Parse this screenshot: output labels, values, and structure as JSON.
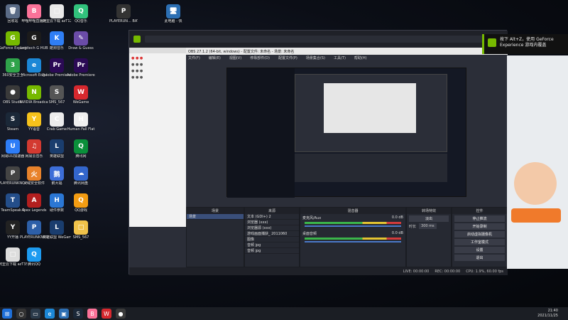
{
  "desktop": {
    "icons": [
      {
        "label": "回收站",
        "glyph": "🗑",
        "color": "#5a6b86"
      },
      {
        "label": "哔哩哔哩直播姬",
        "glyph": "B",
        "color": "#fb7299"
      },
      {
        "label": "GeForce Experience",
        "glyph": "G",
        "color": "#76b900"
      },
      {
        "label": "Logitech G HUB",
        "glyph": "G",
        "color": "#1b1b1b"
      },
      {
        "label": "360安全卫士",
        "glyph": "3",
        "color": "#2fa34a"
      },
      {
        "label": "Microsoft Edge",
        "glyph": "e",
        "color": "#1c87d6"
      },
      {
        "label": "OBS Studio",
        "glyph": "●",
        "color": "#3a3a3a"
      },
      {
        "label": "NVIDIA Broadcast",
        "glyph": "N",
        "color": "#76b900"
      },
      {
        "label": "Steam",
        "glyph": "S",
        "color": "#1b2838"
      },
      {
        "label": "YY语音",
        "glyph": "Y",
        "color": "#f6c21b"
      },
      {
        "label": "网易UU加速器",
        "glyph": "U",
        "color": "#2e7df7"
      },
      {
        "label": "网易云音乐",
        "glyph": "♫",
        "color": "#d33a31"
      },
      {
        "label": "PLAYERUNKNOWN'S BATTLEGROUNDS",
        "glyph": "P",
        "color": "#444"
      },
      {
        "label": "火绒安全软件",
        "glyph": "火",
        "color": "#e8822b"
      },
      {
        "label": "TeamSpeak 3",
        "glyph": "T",
        "color": "#244e8a"
      },
      {
        "label": "Apex Legends",
        "glyph": "A",
        "color": "#b21f1f"
      },
      {
        "label": "YY开播",
        "glyph": "Y",
        "color": "#222"
      },
      {
        "label": "PLAYERUNKNOWN'S BATTLEGROUNDS",
        "glyph": "P",
        "color": "#2d5fa8"
      },
      {
        "label": "阿里云下载 azT35",
        "glyph": "□",
        "color": "#ddd"
      },
      {
        "label": "腾讯QQ",
        "glyph": "Q",
        "color": "#1d9bf0"
      }
    ],
    "column2_icons": [
      {
        "label": "阿里云下载 azT125",
        "glyph": "□",
        "color": "#e9e9e9"
      },
      {
        "label": "QQ音乐",
        "glyph": "Q",
        "color": "#31c27c"
      },
      {
        "label": "酷狗音乐",
        "glyph": "K",
        "color": "#2f7ef5"
      },
      {
        "label": "Draw & Guess",
        "glyph": "✎",
        "color": "#6b4ca8"
      },
      {
        "label": "Adobe Premiere ...",
        "glyph": "Pr",
        "color": "#2b0a55"
      },
      {
        "label": "Adobe Premiere Pro 2020",
        "glyph": "Pr",
        "color": "#2b0a55"
      },
      {
        "label": "SMS_567",
        "glyph": "S",
        "color": "#555"
      },
      {
        "label": "WeGame",
        "glyph": "W",
        "color": "#d7282e"
      },
      {
        "label": "Crab Game",
        "glyph": "C",
        "color": "#ececec"
      },
      {
        "label": "Human Fall Flat",
        "glyph": "H",
        "color": "#f0f0f0"
      },
      {
        "label": "英雄联盟",
        "glyph": "L",
        "color": "#1a3d6e"
      },
      {
        "label": "腾讯网",
        "glyph": "Q",
        "color": "#0a8f3a"
      },
      {
        "label": "鹅大福",
        "glyph": "鹅",
        "color": "#3d6ed8"
      },
      {
        "label": "腾讯网盘",
        "glyph": "☁",
        "color": "#3366cc"
      },
      {
        "label": "硬件参数",
        "glyph": "H",
        "color": "#2b77d4"
      },
      {
        "label": "QQ游戏",
        "glyph": "Q",
        "color": "#f39c12"
      },
      {
        "label": "英雄联盟 WeGame版",
        "glyph": "L",
        "color": "#1a3d6e"
      },
      {
        "label": "SMS_567",
        "glyph": "□",
        "color": "#f0c24a"
      }
    ],
    "folder_icons": [
      {
        "label": "PLAYERUN... BATTLEG...",
        "glyph": "P",
        "color": "#333"
      },
      {
        "label": "此电脑 - 快",
        "glyph": "🖥",
        "color": "#2c6fb3"
      }
    ]
  },
  "obs": {
    "title": "OBS 27.1.2 (64-bit, windows) - 配置文件: 未命名 - 场景: 未命名",
    "menu": [
      "文件(F)",
      "编辑(E)",
      "视图(V)",
      "停靠部件(D)",
      "配置文件(P)",
      "场景集合(S)",
      "工具(T)",
      "帮助(H)"
    ],
    "scene_panel_title": "场景",
    "scene_item": "场景",
    "sources_panel_title": "来源",
    "sources": [
      "文本 (GDI+) 2",
      "浏览器 (xxx)",
      "浏览器源 (xxx)",
      "游戏画面捕获_ 2011060",
      "图像",
      "音频 jpg",
      "音频 jpg"
    ],
    "mixer_title": "混音器",
    "mixer_tracks": [
      {
        "name": "麦克风/Aux",
        "db": "0.0 dB"
      },
      {
        "name": "桌面音频",
        "db": "0.0 dB"
      }
    ],
    "transitions_title": "转场特效",
    "transition_type": "淡出",
    "transition_duration_label": "时长",
    "transition_duration": "300 ms",
    "controls_title": "控件",
    "controls": [
      "停止推流",
      "开始录制",
      "启动虚拟摄像机",
      "工作室模式",
      "设置",
      "退出"
    ],
    "status": {
      "live": "LIVE: 00:00:00",
      "rec": "REC: 00:00:00",
      "cpu": "CPU: 1.9%, 60.00 fps"
    }
  },
  "gfe": {
    "text": "按下 Alt+Z，使用 GeForce Experience 游戏内覆盖"
  },
  "taskbar": {
    "time": "21:40",
    "date": "2021/11/25"
  }
}
